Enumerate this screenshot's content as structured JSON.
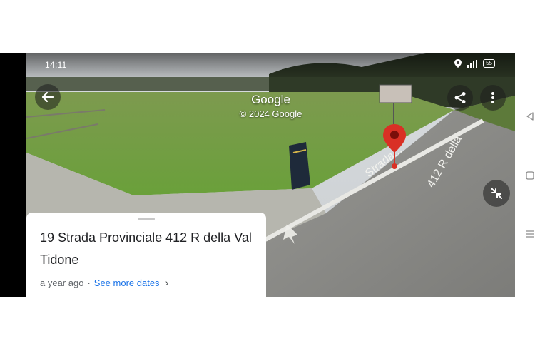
{
  "status_bar": {
    "time": "14:11",
    "battery": "55"
  },
  "viewer": {
    "brand": "Google",
    "copyright": "© 2024 Google"
  },
  "location_card": {
    "address": "19 Strada Provinciale 412 R della Val Tidone",
    "capture_age": "a year ago",
    "separator": "·",
    "see_more_dates": "See more dates"
  },
  "colors": {
    "pin": "#d93025",
    "link": "#1a73e8",
    "grass": "#6f9a3c",
    "road": "#8b8b87"
  },
  "icons": [
    "back-arrow-icon",
    "share-icon",
    "more-vert-icon",
    "collapse-icon",
    "location-icon",
    "signal-icon",
    "battery-icon",
    "nav-back-icon",
    "nav-home-icon",
    "nav-recents-icon"
  ]
}
